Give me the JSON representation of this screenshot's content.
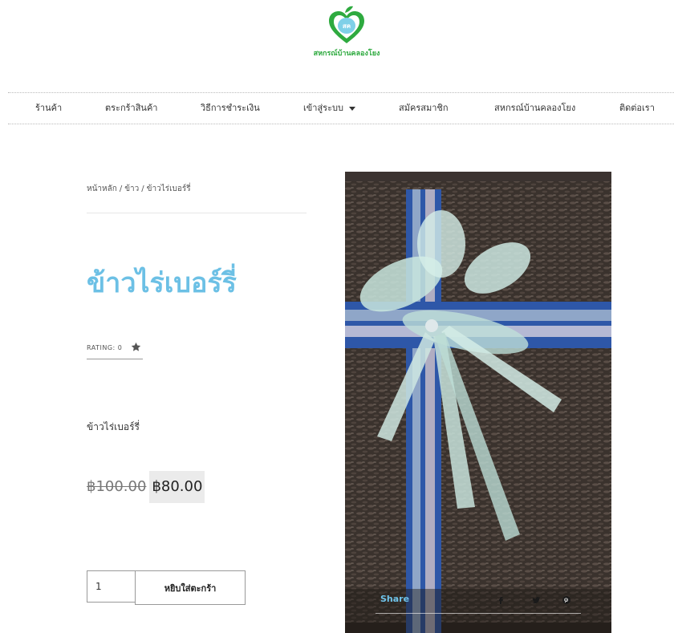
{
  "logo": {
    "text": "สหกรณ์บ้านคลองโยง",
    "emblem_text": "สค",
    "brand_color": "#2eaa3f"
  },
  "nav": {
    "items": [
      {
        "label": "ร้านค้า"
      },
      {
        "label": "ตระกร้าสินค้า"
      },
      {
        "label": "วิธีการชำระเงิน"
      },
      {
        "label": "เข้าสู่ระบบ",
        "has_dropdown": true
      },
      {
        "label": "สมัครสมาชิก"
      },
      {
        "label": "สหกรณ์บ้านคลองโยง"
      },
      {
        "label": "ติดต่อเรา"
      }
    ]
  },
  "breadcrumb": {
    "home": "หน้าหลัก",
    "sep": "/",
    "category": "ข้าว",
    "current": "ข้าวไร่เบอร์รี่"
  },
  "product": {
    "title": "ข้าวไร่เบอร์รี่",
    "title_color": "#6cc0e5",
    "rating_label": "RATING:",
    "rating_value": "0",
    "short_description": "ข้าวไร่เบอร์รี่",
    "regular_price": "฿100.00",
    "sale_price": "฿80.00"
  },
  "cart": {
    "quantity": "1",
    "add_button": "หยิบใส่ตะกร้า"
  },
  "image": {
    "share_label": "Share",
    "share_color": "#6ec3ea",
    "share_icons": [
      "facebook-icon",
      "twitter-icon",
      "pinterest-icon"
    ]
  }
}
